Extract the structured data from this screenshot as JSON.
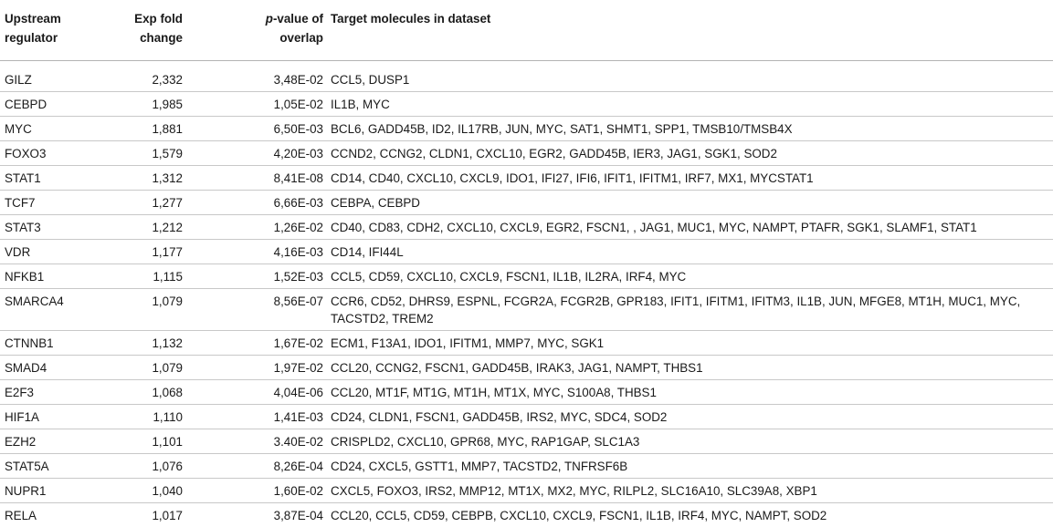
{
  "header": {
    "regulator": [
      "Upstream",
      "regulator"
    ],
    "fold": [
      "Exp fold",
      "change"
    ],
    "pvalue_italic": "p",
    "pvalue_rest": [
      "-value of",
      "overlap"
    ],
    "targets": "Target molecules in dataset"
  },
  "rows": [
    {
      "regulator": "GILZ",
      "fold": "2,332",
      "pvalue": "3,48E-02",
      "targets": "CCL5, DUSP1"
    },
    {
      "regulator": "CEBPD",
      "fold": "1,985",
      "pvalue": "1,05E-02",
      "targets": "IL1B, MYC"
    },
    {
      "regulator": "MYC",
      "fold": "1,881",
      "pvalue": "6,50E-03",
      "targets": "BCL6, GADD45B, ID2, IL17RB, JUN, MYC, SAT1, SHMT1, SPP1, TMSB10/TMSB4X"
    },
    {
      "regulator": "FOXO3",
      "fold": "1,579",
      "pvalue": "4,20E-03",
      "targets": "CCND2, CCNG2, CLDN1, CXCL10, EGR2, GADD45B, IER3, JAG1, SGK1, SOD2"
    },
    {
      "regulator": "STAT1",
      "fold": "1,312",
      "pvalue": "8,41E-08",
      "targets": "CD14, CD40, CXCL10, CXCL9, IDO1, IFI27, IFI6, IFIT1, IFITM1, IRF7, MX1, MYCSTAT1"
    },
    {
      "regulator": "TCF7",
      "fold": "1,277",
      "pvalue": "6,66E-03",
      "targets": "CEBPA, CEBPD"
    },
    {
      "regulator": "STAT3",
      "fold": "1,212",
      "pvalue": "1,26E-02",
      "targets": "CD40, CD83, CDH2, CXCL10, CXCL9, EGR2, FSCN1, , JAG1, MUC1, MYC, NAMPT, PTAFR, SGK1, SLAMF1, STAT1"
    },
    {
      "regulator": "VDR",
      "fold": "1,177",
      "pvalue": "4,16E-03",
      "targets": "CD14, IFI44L"
    },
    {
      "regulator": "NFKB1",
      "fold": "1,115",
      "pvalue": "1,52E-03",
      "targets": "CCL5, CD59, CXCL10, CXCL9, FSCN1, IL1B, IL2RA, IRF4, MYC"
    },
    {
      "regulator": "SMARCA4",
      "fold": "1,079",
      "pvalue": "8,56E-07",
      "targets": "CCR6, CD52, DHRS9, ESPNL, FCGR2A, FCGR2B, GPR183, IFIT1, IFITM1, IFITM3, IL1B, JUN, MFGE8, MT1H, MUC1, MYC, TACSTD2, TREM2"
    },
    {
      "regulator": "CTNNB1",
      "fold": "1,132",
      "pvalue": "1,67E-02",
      "targets": "ECM1, F13A1, IDO1, IFITM1, MMP7, MYC, SGK1"
    },
    {
      "regulator": "SMAD4",
      "fold": "1,079",
      "pvalue": "1,97E-02",
      "targets": "CCL20, CCNG2, FSCN1, GADD45B, IRAK3, JAG1, NAMPT, THBS1"
    },
    {
      "regulator": "E2F3",
      "fold": "1,068",
      "pvalue": "4,04E-06",
      "targets": "CCL20, MT1F, MT1G, MT1H, MT1X, MYC, S100A8, THBS1"
    },
    {
      "regulator": "HIF1A",
      "fold": "1,110",
      "pvalue": "1,41E-03",
      "targets": "CD24, CLDN1, FSCN1, GADD45B, IRS2, MYC, SDC4, SOD2"
    },
    {
      "regulator": "EZH2",
      "fold": "1,101",
      "pvalue": "3.40E-02",
      "targets": "CRISPLD2, CXCL10, GPR68, MYC, RAP1GAP, SLC1A3"
    },
    {
      "regulator": "STAT5A",
      "fold": "1,076",
      "pvalue": "8,26E-04",
      "targets": "CD24, CXCL5, GSTT1, MMP7, TACSTD2, TNFRSF6B"
    },
    {
      "regulator": "NUPR1",
      "fold": "1,040",
      "pvalue": "1,60E-02",
      "targets": "CXCL5, FOXO3, IRS2, MMP12, MT1X, MX2, MYC, RILPL2, SLC16A10, SLC39A8, XBP1"
    },
    {
      "regulator": "RELA",
      "fold": "1,017",
      "pvalue": "3,87E-04",
      "targets": "CCL20, CCL5, CD59, CEBPB, CXCL10, CXCL9, FSCN1, IL1B, IRF4, MYC, NAMPT, SOD2"
    }
  ]
}
